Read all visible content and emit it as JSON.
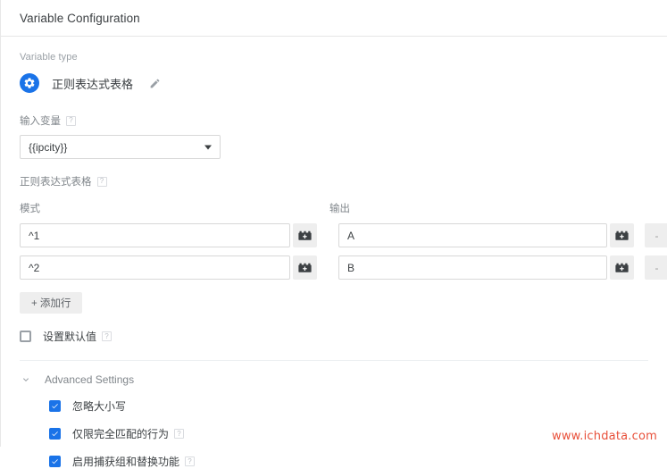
{
  "header": {
    "title": "Variable Configuration"
  },
  "variable_type": {
    "label": "Variable type",
    "icon": "gear-icon",
    "name": "正则表达式表格",
    "edit_icon": "pencil-icon"
  },
  "input_variable": {
    "label": "输入变量",
    "help": "?",
    "value": "{{ipcity}}",
    "dropdown_icon": "chevron-down-icon"
  },
  "regex_table": {
    "label": "正则表达式表格",
    "help": "?",
    "columns": [
      "模式",
      "输出"
    ],
    "rows": [
      {
        "pattern": "^1",
        "output": "A",
        "pattern_picker_icon": "lego-block-icon",
        "output_picker_icon": "lego-block-icon",
        "remove_label": "-"
      },
      {
        "pattern": "^2",
        "output": "B",
        "pattern_picker_icon": "lego-block-icon",
        "output_picker_icon": "lego-block-icon",
        "remove_label": "-"
      }
    ],
    "add_row_label": "+ 添加行"
  },
  "default_value": {
    "label": "设置默认值",
    "help": "?",
    "checked": false
  },
  "advanced_settings": {
    "title": "Advanced Settings",
    "expand_icon": "chevron-down-icon",
    "options": [
      {
        "label": "忽略大小写",
        "checked": true,
        "help": null
      },
      {
        "label": "仅限完全匹配的行为",
        "checked": true,
        "help": "?"
      },
      {
        "label": "启用捕获组和替换功能",
        "checked": true,
        "help": "?"
      }
    ]
  },
  "watermark": {
    "text": "www.ichdata.com",
    "color": "#e8503a"
  },
  "colors": {
    "accent": "#1a73e8",
    "text": "#3c4043",
    "muted": "#80868b",
    "border": "#d8d8d8",
    "button_bg": "#eeeeee"
  }
}
